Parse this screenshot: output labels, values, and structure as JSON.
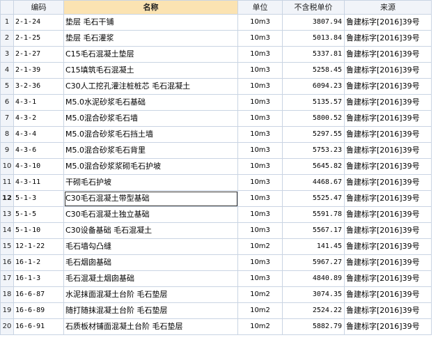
{
  "headers": {
    "index": "",
    "code": "编码",
    "name": "名称",
    "unit": "单位",
    "price": "不含税单价",
    "source": "来源"
  },
  "rows": [
    {
      "index": "1",
      "code": "2-1-24",
      "name": "垫层 毛石干铺",
      "unit": "10m3",
      "price": "3807.94",
      "source": "鲁建标字[2016]39号"
    },
    {
      "index": "2",
      "code": "2-1-25",
      "name": "垫层 毛石灌浆",
      "unit": "10m3",
      "price": "5013.84",
      "source": "鲁建标字[2016]39号"
    },
    {
      "index": "3",
      "code": "2-1-27",
      "name": "C15毛石混凝土垫层",
      "unit": "10m3",
      "price": "5337.81",
      "source": "鲁建标字[2016]39号"
    },
    {
      "index": "4",
      "code": "2-1-39",
      "name": "C15填筑毛石混凝土",
      "unit": "10m3",
      "price": "5258.45",
      "source": "鲁建标字[2016]39号"
    },
    {
      "index": "5",
      "code": "3-2-36",
      "name": "C30人工挖孔灌注桩桩芯 毛石混凝土",
      "unit": "10m3",
      "price": "6094.23",
      "source": "鲁建标字[2016]39号"
    },
    {
      "index": "6",
      "code": "4-3-1",
      "name": "M5.0水泥砂浆毛石基础",
      "unit": "10m3",
      "price": "5135.57",
      "source": "鲁建标字[2016]39号"
    },
    {
      "index": "7",
      "code": "4-3-2",
      "name": "M5.0混合砂浆毛石墙",
      "unit": "10m3",
      "price": "5800.52",
      "source": "鲁建标字[2016]39号"
    },
    {
      "index": "8",
      "code": "4-3-4",
      "name": "M5.0混合砂浆毛石挡土墙",
      "unit": "10m3",
      "price": "5297.55",
      "source": "鲁建标字[2016]39号"
    },
    {
      "index": "9",
      "code": "4-3-6",
      "name": "M5.0混合砂浆毛石背里",
      "unit": "10m3",
      "price": "5753.23",
      "source": "鲁建标字[2016]39号"
    },
    {
      "index": "10",
      "code": "4-3-10",
      "name": "M5.0混合砂浆浆砌毛石护坡",
      "unit": "10m3",
      "price": "5645.82",
      "source": "鲁建标字[2016]39号"
    },
    {
      "index": "11",
      "code": "4-3-11",
      "name": "干砌毛石护坡",
      "unit": "10m3",
      "price": "4468.67",
      "source": "鲁建标字[2016]39号"
    },
    {
      "index": "12",
      "code": "5-1-3",
      "name": "C30毛石混凝土带型基础",
      "unit": "10m3",
      "price": "5525.47",
      "source": "鲁建标字[2016]39号"
    },
    {
      "index": "13",
      "code": "5-1-5",
      "name": "C30毛石混凝土独立基础",
      "unit": "10m3",
      "price": "5591.78",
      "source": "鲁建标字[2016]39号"
    },
    {
      "index": "14",
      "code": "5-1-10",
      "name": "C30设备基础 毛石混凝土",
      "unit": "10m3",
      "price": "5567.17",
      "source": "鲁建标字[2016]39号"
    },
    {
      "index": "15",
      "code": "12-1-22",
      "name": "毛石墙勾凸缝",
      "unit": "10m2",
      "price": "141.45",
      "source": "鲁建标字[2016]39号"
    },
    {
      "index": "16",
      "code": "16-1-2",
      "name": "毛石烟囱基础",
      "unit": "10m3",
      "price": "5967.27",
      "source": "鲁建标字[2016]39号"
    },
    {
      "index": "17",
      "code": "16-1-3",
      "name": "毛石混凝土烟囱基础",
      "unit": "10m3",
      "price": "4840.89",
      "source": "鲁建标字[2016]39号"
    },
    {
      "index": "18",
      "code": "16-6-87",
      "name": "水泥抹面混凝土台阶 毛石垫层",
      "unit": "10m2",
      "price": "3074.35",
      "source": "鲁建标字[2016]39号"
    },
    {
      "index": "19",
      "code": "16-6-89",
      "name": "随打随抹混凝土台阶 毛石垫层",
      "unit": "10m2",
      "price": "2524.22",
      "source": "鲁建标字[2016]39号"
    },
    {
      "index": "20",
      "code": "16-6-91",
      "name": "石质板材铺面混凝土台阶 毛石垫层",
      "unit": "10m2",
      "price": "5882.79",
      "source": "鲁建标字[2016]39号"
    }
  ],
  "current_row": "12",
  "colors": {
    "header_bg": "#f1f4f9",
    "name_header_bg": "#fbe3b2",
    "grid_line": "#c9d4e3"
  }
}
